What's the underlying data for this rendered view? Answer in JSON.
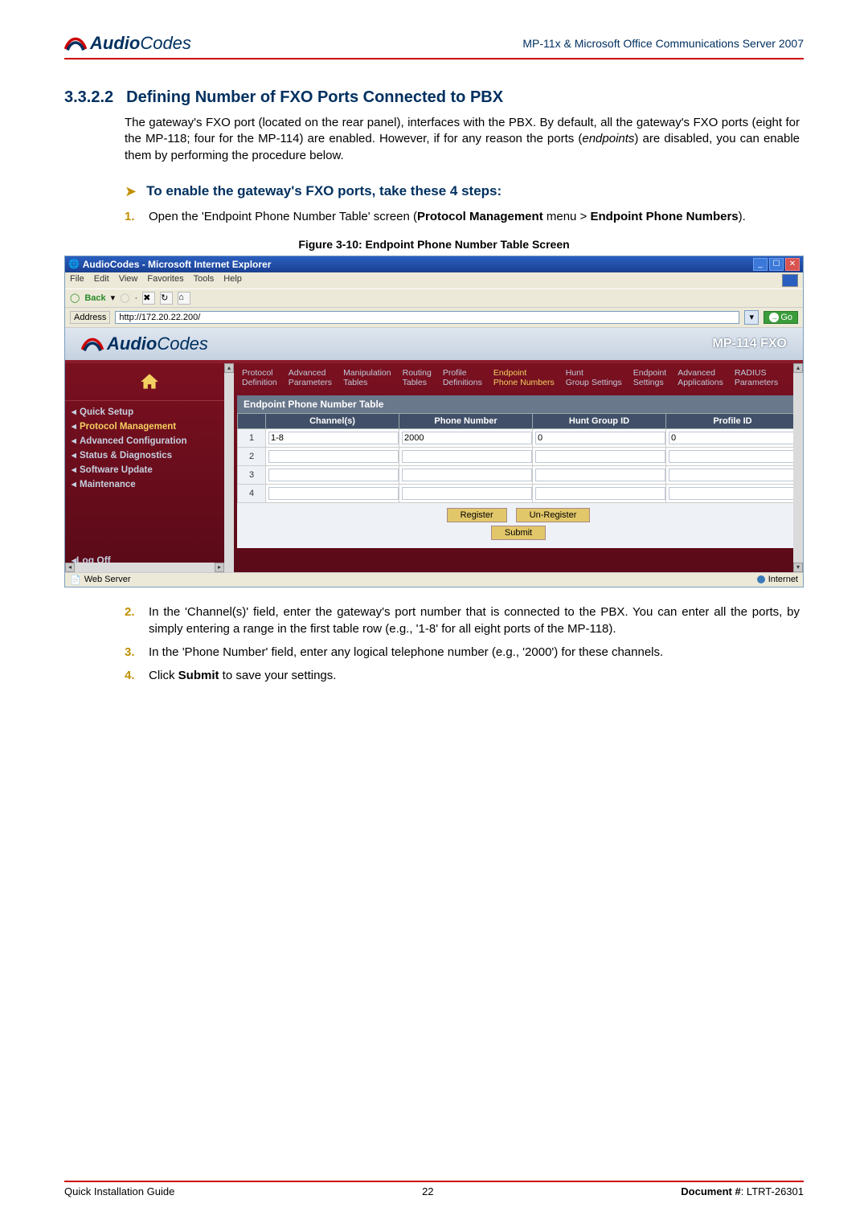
{
  "header": {
    "product": "MP-11x & Microsoft Office Communications Server 2007",
    "logo_main": "Audio",
    "logo_sub": "Codes"
  },
  "section": {
    "num": "3.3.2.2",
    "title": "Defining Number of FXO Ports Connected to PBX",
    "para1a": "The gateway's FXO port (located on the rear panel), interfaces with the PBX. By default, all the gateway's FXO ports (eight for the MP-118; four for the MP-114) are enabled. However, if for any reason the ports (",
    "para1i": "endpoints",
    "para1b": ") are disabled, you can enable them by performing the procedure below.",
    "sub": "To enable the gateway's FXO ports, take these 4 steps:",
    "step1a": "Open the 'Endpoint Phone Number Table' screen (",
    "step1b": "Protocol Management",
    "step1c": " menu > ",
    "step1d": "Endpoint Phone Numbers",
    "step1e": ").",
    "figcap": "Figure 3-10: Endpoint Phone Number Table Screen",
    "step2": "In the 'Channel(s)' field, enter the gateway's port number that is connected to the PBX. You can enter all the ports, by simply entering a range in the first table row (e.g., '1-8' for all eight ports of the MP-118).",
    "step3": "In the 'Phone Number' field, enter any logical telephone number (e.g., '2000') for these channels.",
    "step4a": "Click ",
    "step4b": "Submit",
    "step4c": " to save your settings."
  },
  "ie": {
    "title": "AudioCodes - Microsoft Internet Explorer",
    "menu": [
      "File",
      "Edit",
      "View",
      "Favorites",
      "Tools",
      "Help"
    ],
    "back": "Back",
    "addr_lbl": "Address",
    "addr_val": "http://172.20.22.200/",
    "go": "Go",
    "status_l": "Web Server",
    "status_r": "Internet"
  },
  "app": {
    "brand_main": "Audio",
    "brand_sub": "Codes",
    "product": "MP-114 FXO",
    "nav": [
      "Quick Setup",
      "Protocol Management",
      "Advanced Configuration",
      "Status & Diagnostics",
      "Software Update",
      "Maintenance"
    ],
    "nav_active_index": 1,
    "logoff": "Log Off",
    "tabs": [
      "Protocol Definition",
      "Advanced Parameters",
      "Manipulation Tables",
      "Routing Tables",
      "Profile Definitions",
      "Endpoint Phone Numbers",
      "Hunt Group Settings",
      "Endpoint Settings",
      "Advanced Applications",
      "RADIUS Parameters"
    ],
    "tabs_sel_index": 5,
    "panel_title": "Endpoint Phone Number Table",
    "cols": [
      "Channel(s)",
      "Phone Number",
      "Hunt Group ID",
      "Profile ID"
    ],
    "rows": [
      {
        "idx": "1",
        "ch": "1-8",
        "pn": "2000",
        "hg": "0",
        "pid": "0"
      },
      {
        "idx": "2",
        "ch": "",
        "pn": "",
        "hg": "",
        "pid": ""
      },
      {
        "idx": "3",
        "ch": "",
        "pn": "",
        "hg": "",
        "pid": ""
      },
      {
        "idx": "4",
        "ch": "",
        "pn": "",
        "hg": "",
        "pid": ""
      }
    ],
    "btn_register": "Register",
    "btn_unregister": "Un-Register",
    "btn_submit": "Submit"
  },
  "footer": {
    "left": "Quick Installation Guide",
    "center": "22",
    "right_label": "Document #",
    "right_val": ": LTRT-26301"
  }
}
